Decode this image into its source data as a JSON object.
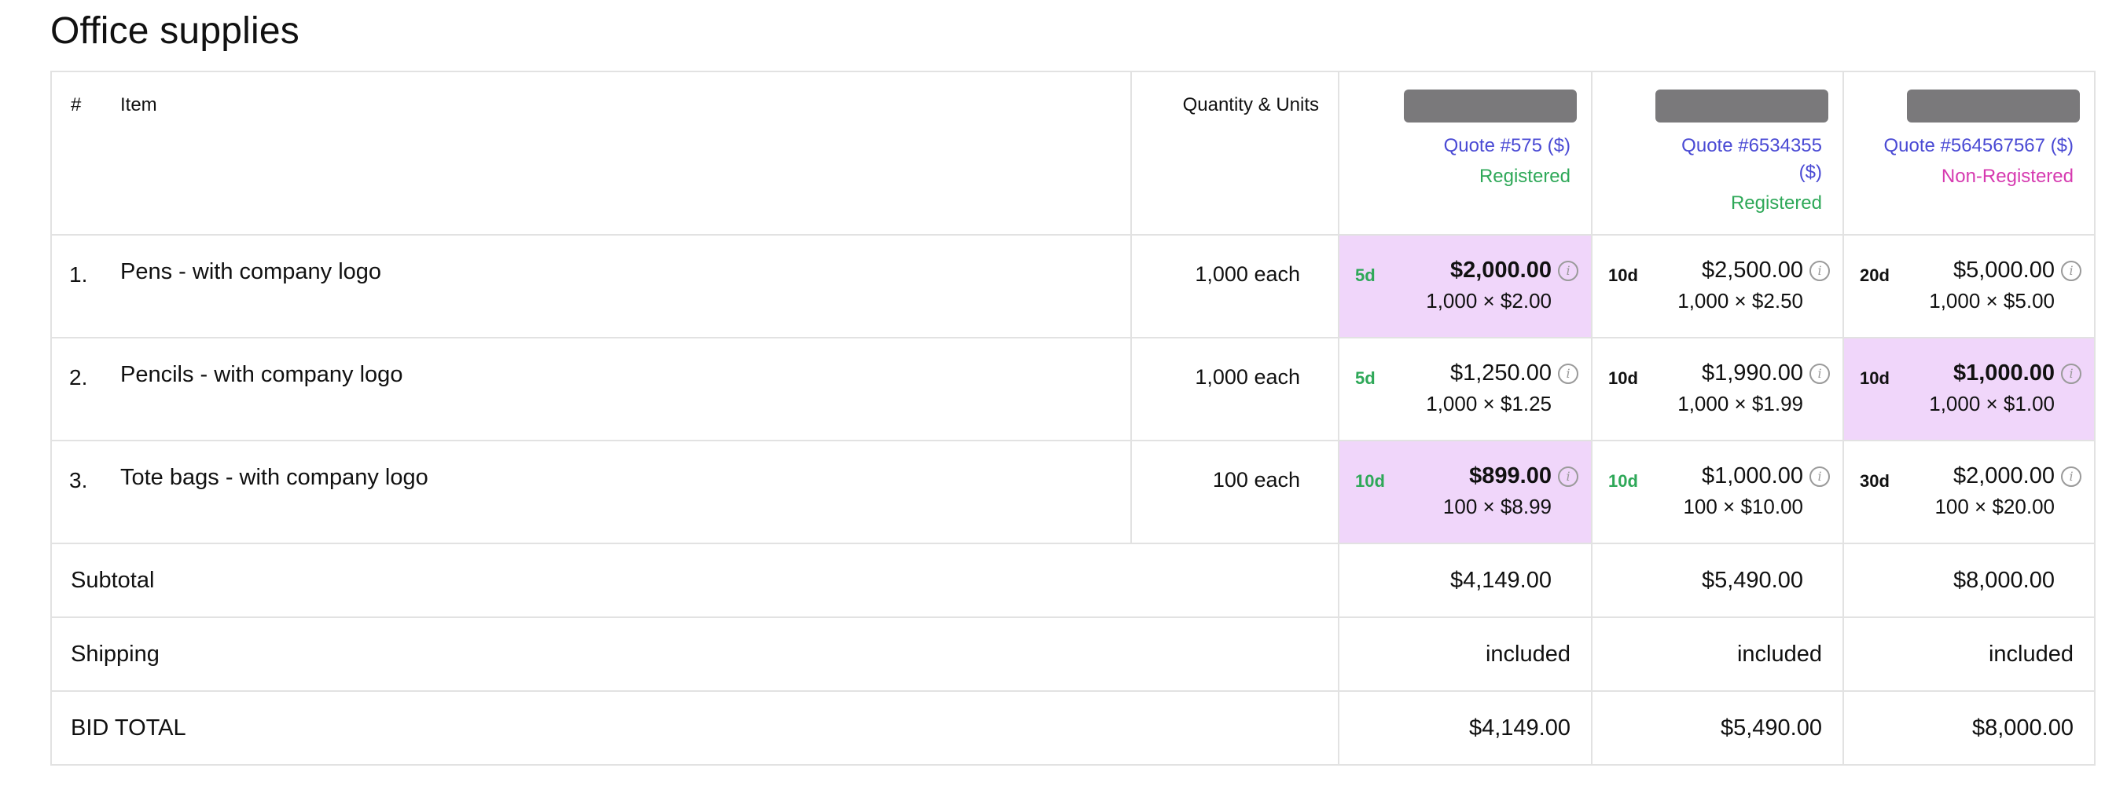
{
  "page": {
    "title": "Office supplies"
  },
  "table": {
    "headers": {
      "num": "#",
      "item": "Item",
      "qty": "Quantity & Units"
    },
    "quotes": [
      {
        "link": "Quote #575 ($)",
        "status": "Registered"
      },
      {
        "link": "Quote #6534355 ($)",
        "status": "Registered"
      },
      {
        "link": "Quote #564567567 ($)",
        "status": "Non-Registered"
      }
    ],
    "rows": [
      {
        "num": "1.",
        "item": "Pens - with company logo",
        "qty": "1,000 each",
        "cells": [
          {
            "days": "5d",
            "price": "$2,000.00",
            "calc": "1,000 × $2.00"
          },
          {
            "days": "10d",
            "price": "$2,500.00",
            "calc": "1,000 × $2.50"
          },
          {
            "days": "20d",
            "price": "$5,000.00",
            "calc": "1,000 × $5.00"
          }
        ]
      },
      {
        "num": "2.",
        "item": "Pencils - with company logo",
        "qty": "1,000 each",
        "cells": [
          {
            "days": "5d",
            "price": "$1,250.00",
            "calc": "1,000 × $1.25"
          },
          {
            "days": "10d",
            "price": "$1,990.00",
            "calc": "1,000 × $1.99"
          },
          {
            "days": "10d",
            "price": "$1,000.00",
            "calc": "1,000 × $1.00"
          }
        ]
      },
      {
        "num": "3.",
        "item": "Tote bags - with company logo",
        "qty": "100 each",
        "cells": [
          {
            "days": "10d",
            "price": "$899.00",
            "calc": "100 × $8.99"
          },
          {
            "days": "10d",
            "price": "$1,000.00",
            "calc": "100 × $10.00"
          },
          {
            "days": "30d",
            "price": "$2,000.00",
            "calc": "100 × $20.00"
          }
        ]
      }
    ],
    "summary": {
      "subtotal": {
        "label": "Subtotal",
        "values": [
          "$4,149.00",
          "$5,490.00",
          "$8,000.00"
        ]
      },
      "shipping": {
        "label": "Shipping",
        "values": [
          "included",
          "included",
          "included"
        ]
      },
      "total": {
        "label": "BID TOTAL",
        "values": [
          "$4,149.00",
          "$5,490.00",
          "$8,000.00"
        ]
      }
    },
    "info_icon_glyph": "i"
  },
  "colors": {
    "highlight": "#f0d6fa",
    "link": "#4a4ad4",
    "registered": "#2ea858",
    "non_registered": "#d63ab0",
    "redacted": "#7a797b"
  },
  "icons": {
    "info": "info-circle-icon"
  }
}
